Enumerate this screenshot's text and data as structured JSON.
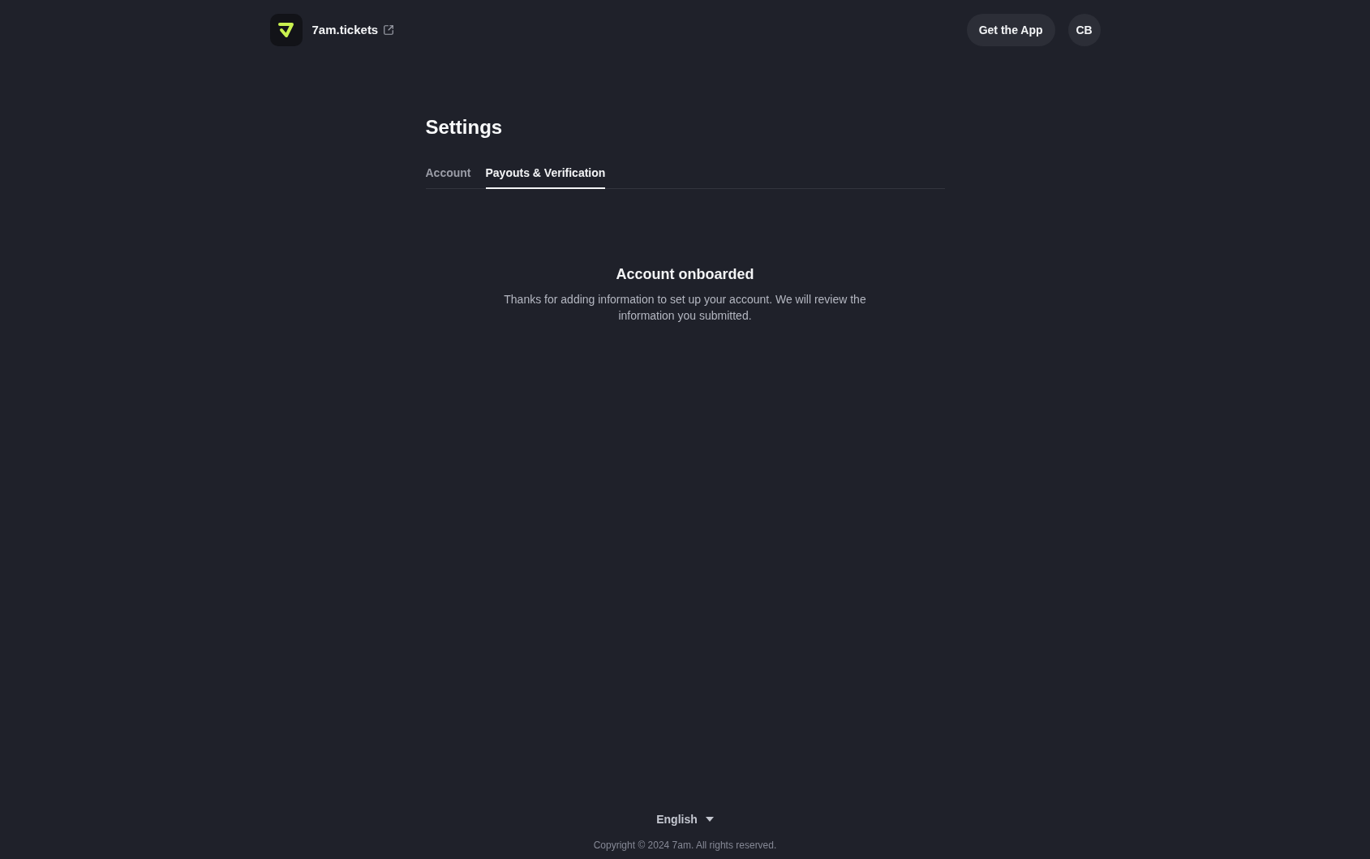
{
  "header": {
    "brand": {
      "name": "7am.tickets"
    },
    "get_app_button": "Get the App",
    "avatar_initials": "CB"
  },
  "page_title": "Settings",
  "tabs": [
    {
      "label": "Account",
      "selected": false
    },
    {
      "label": "Payouts & Verification",
      "selected": true
    }
  ],
  "status": {
    "title": "Account onboarded",
    "message": "Thanks for adding information to set up your account. We will review the information you submitted."
  },
  "footer": {
    "language": "English",
    "copyright": "Copyright © 2024 7am. All rights reserved."
  }
}
